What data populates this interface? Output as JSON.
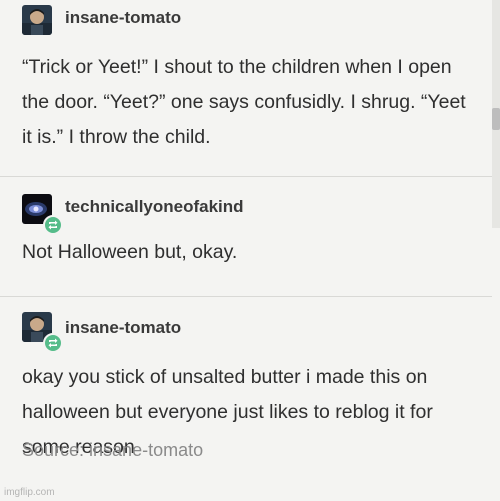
{
  "posts": [
    {
      "username": "insane-tomato",
      "reblog": false,
      "text": "“Trick or Yeet!” I shout to the children when I open the door. “Yeet?” one says confusidly. I shrug. “Yeet it is.” I throw the child."
    },
    {
      "username": "technicallyoneofakind",
      "reblog": true,
      "text": "Not Halloween but, okay."
    },
    {
      "username": "insane-tomato",
      "reblog": true,
      "text": "okay you stick of unsalted butter i made this on halloween but everyone just likes to reblog it for some reason"
    }
  ],
  "source": "Source: insane-tomato",
  "watermark": "imgflip.com",
  "colors": {
    "background": "#f4f4f2",
    "reblog_badge": "#56bc8a",
    "text": "#2f2f2f",
    "source_text": "#8a8a8a"
  }
}
